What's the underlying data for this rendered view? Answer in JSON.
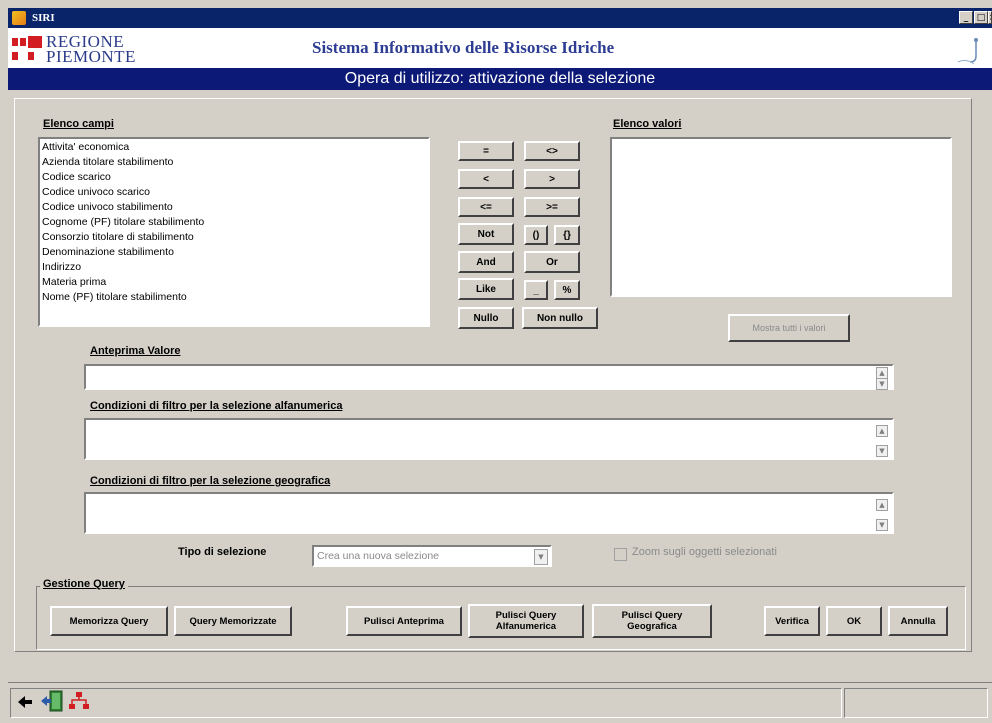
{
  "window": {
    "title": "SIRI",
    "minimize": "_",
    "maximize": "□",
    "close": "×"
  },
  "header": {
    "logo_line1": "REGIONE",
    "logo_line2": "PIEMONTE",
    "system_title": "Sistema Informativo delle Risorse Idriche",
    "subtitle": "Opera di utilizzo: attivazione della selezione"
  },
  "fields": {
    "label": "Elenco campi",
    "items": [
      "Attivita' economica",
      "Azienda titolare stabilimento",
      "Codice scarico",
      "Codice univoco scarico",
      "Codice univoco stabilimento",
      "Cognome (PF) titolare stabilimento",
      "Consorzio titolare di stabilimento",
      "Denominazione stabilimento",
      "Indirizzo",
      "Materia prima",
      "Nome (PF) titolare stabilimento"
    ]
  },
  "operators": {
    "eq": "=",
    "neq": "<>",
    "lt": "<",
    "gt": ">",
    "lte": "<=",
    "gte": ">=",
    "not": "Not",
    "paren": "()",
    "brace": "{}",
    "and": "And",
    "or": "Or",
    "like": "Like",
    "underscore": "_",
    "percent": "%",
    "null": "Nullo",
    "not_null": "Non nullo"
  },
  "values": {
    "label": "Elenco valori",
    "show_all": "Mostra tutti i valori"
  },
  "preview": {
    "label": "Anteprima Valore",
    "value": ""
  },
  "alpha_filter": {
    "label": "Condizioni di filtro per la selezione alfanumerica",
    "value": ""
  },
  "geo_filter": {
    "label": "Condizioni di filtro per la selezione geografica",
    "value": ""
  },
  "selection_type": {
    "label": "Tipo di selezione",
    "value": "Crea una nuova selezione"
  },
  "zoom": {
    "label": "Zoom sugli oggetti selezionati",
    "checked": false
  },
  "query": {
    "legend": "Gestione Query",
    "save": "Memorizza Query",
    "saved": "Query Memorizzate",
    "clear_preview": "Pulisci Anteprima",
    "clear_alpha_1": "Pulisci Query",
    "clear_alpha_2": "Alfanumerica",
    "clear_geo_1": "Pulisci Query",
    "clear_geo_2": "Geografica",
    "verify": "Verifica",
    "ok": "OK",
    "cancel": "Annulla"
  },
  "statusbar": {
    "icons": [
      "back-arrow-icon",
      "exit-door-icon",
      "network-icon"
    ]
  },
  "colors": {
    "titlebar": "#0a246a",
    "subtitle_bar": "#0c1976",
    "title_text": "#2e3d94",
    "logo_red": "#d21d23",
    "panel": "#d4d0c8"
  }
}
